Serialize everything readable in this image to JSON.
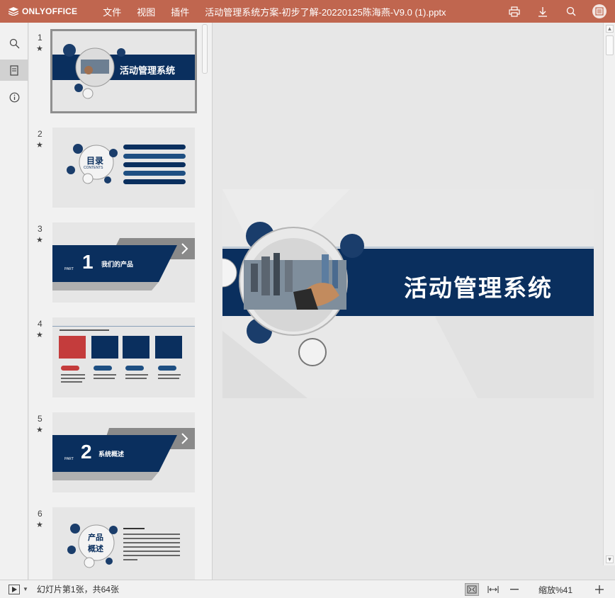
{
  "app": {
    "logo": "ONLYOFFICE",
    "accent": "#c0664f"
  },
  "menu": {
    "file": "文件",
    "view": "视图",
    "plugins": "插件"
  },
  "document": {
    "title": "活动管理系统方案-初步了解-20220125陈海燕-V9.0 (1).pptx"
  },
  "top_icons": [
    "print-icon",
    "download-icon",
    "search-icon",
    "avatar"
  ],
  "left_tools": [
    "search-icon",
    "slides-icon",
    "info-icon"
  ],
  "slides": [
    {
      "number": "1",
      "title": "活动管理系统"
    },
    {
      "number": "2",
      "title": "目录",
      "subtitle": "CONTENTS"
    },
    {
      "number": "3",
      "part_label": "PART",
      "part_number": "1",
      "heading": "我们的产品"
    },
    {
      "number": "4"
    },
    {
      "number": "5",
      "part_label": "PART",
      "part_number": "2",
      "heading": "系统概述"
    },
    {
      "number": "6",
      "title_line1": "产品",
      "title_line2": "概述"
    }
  ],
  "main_slide": {
    "title": "活动管理系统"
  },
  "status": {
    "slide_info": "幻灯片第1张，共64张",
    "zoom": "缩放%41"
  }
}
